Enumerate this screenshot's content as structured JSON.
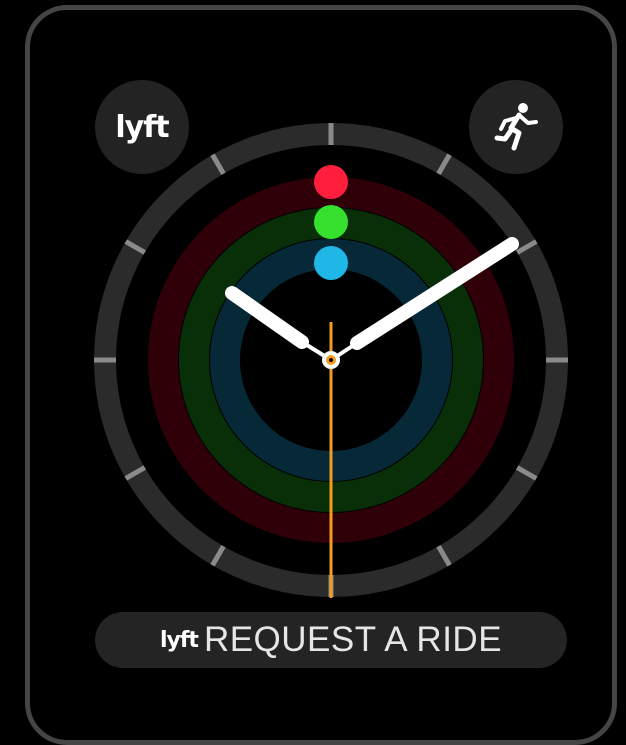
{
  "watch": {
    "complications": {
      "top_left": {
        "logo_text": "lyft",
        "icon": "lyft-logo-icon"
      },
      "top_right": {
        "icon": "running-figure-icon"
      }
    },
    "rings": {
      "move": {
        "color": "#ff1f3c",
        "track": "#2f0008",
        "progress": 0
      },
      "exercise": {
        "color": "#35e02e",
        "track": "#082f07",
        "progress": 0
      },
      "stand": {
        "color": "#1fb8e6",
        "track": "#062837",
        "progress": 0
      }
    },
    "hands": {
      "hour_color": "#ffffff",
      "minute_color": "#ffffff",
      "second_color": "#f39c1f"
    },
    "bottom_complication": {
      "logo_text": "lyft",
      "label": "REQUEST A RIDE"
    }
  }
}
